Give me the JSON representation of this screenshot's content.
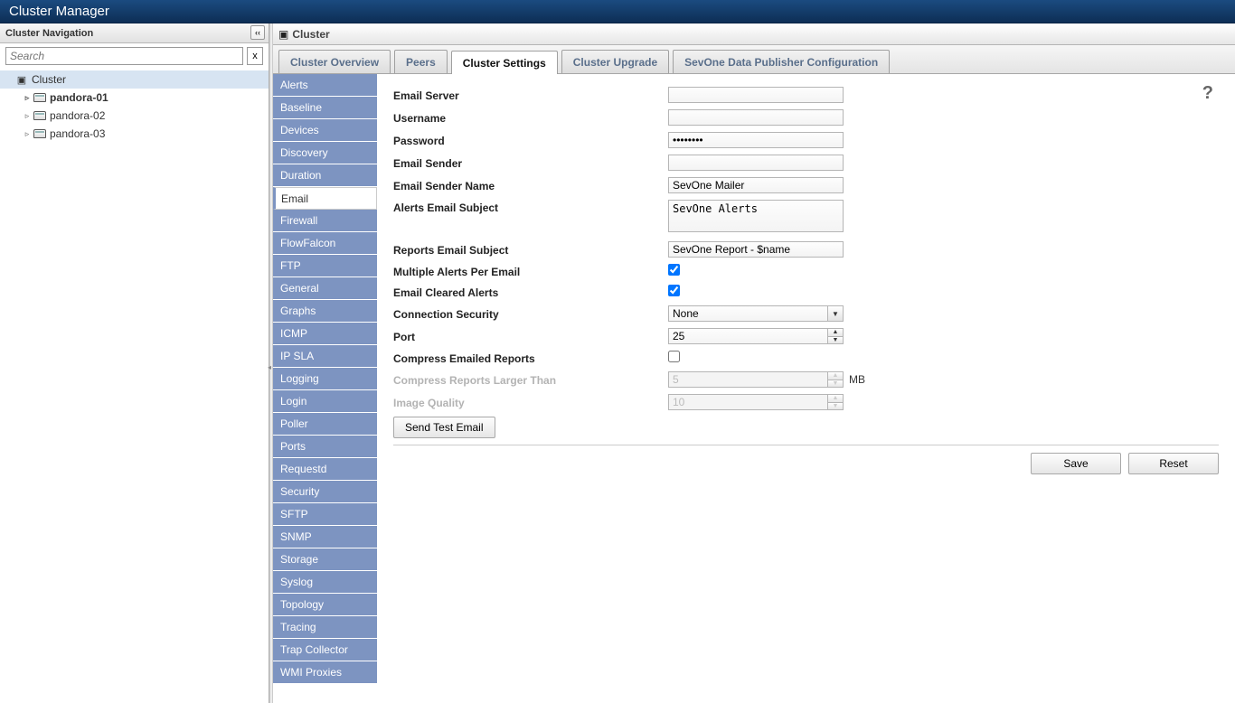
{
  "title": "Cluster Manager",
  "sidebar": {
    "header": "Cluster Navigation",
    "search_placeholder": "Search",
    "clear": "x",
    "root": "Cluster",
    "nodes": [
      {
        "label": "pandora-01",
        "bold": true
      },
      {
        "label": "pandora-02",
        "bold": false
      },
      {
        "label": "pandora-03",
        "bold": false
      }
    ]
  },
  "crumb": "Cluster",
  "tabs": [
    {
      "label": "Cluster Overview",
      "active": false
    },
    {
      "label": "Peers",
      "active": false
    },
    {
      "label": "Cluster Settings",
      "active": true
    },
    {
      "label": "Cluster Upgrade",
      "active": false
    },
    {
      "label": "SevOne Data Publisher Configuration",
      "active": false
    }
  ],
  "settings_nav": [
    "Alerts",
    "Baseline",
    "Devices",
    "Discovery",
    "Duration",
    "Email",
    "Firewall",
    "FlowFalcon",
    "FTP",
    "General",
    "Graphs",
    "ICMP",
    "IP SLA",
    "Logging",
    "Login",
    "Poller",
    "Ports",
    "Requestd",
    "Security",
    "SFTP",
    "SNMP",
    "Storage",
    "Syslog",
    "Topology",
    "Tracing",
    "Trap Collector",
    "WMI Proxies"
  ],
  "settings_nav_active": "Email",
  "form": {
    "email_server": {
      "label": "Email Server",
      "value": ""
    },
    "username": {
      "label": "Username",
      "value": ""
    },
    "password": {
      "label": "Password",
      "value": "••••••••"
    },
    "email_sender": {
      "label": "Email Sender",
      "value": ""
    },
    "email_sender_name": {
      "label": "Email Sender Name",
      "value": "SevOne Mailer"
    },
    "alerts_subject": {
      "label": "Alerts Email Subject",
      "value": "SevOne Alerts"
    },
    "reports_subject": {
      "label": "Reports Email Subject",
      "value": "SevOne Report - $name"
    },
    "multiple_alerts": {
      "label": "Multiple Alerts Per Email",
      "checked": true
    },
    "email_cleared": {
      "label": "Email Cleared Alerts",
      "checked": true
    },
    "conn_security": {
      "label": "Connection Security",
      "value": "None"
    },
    "port": {
      "label": "Port",
      "value": "25"
    },
    "compress": {
      "label": "Compress Emailed Reports",
      "checked": false
    },
    "compress_larger": {
      "label": "Compress Reports Larger Than",
      "value": "5",
      "unit": "MB"
    },
    "image_quality": {
      "label": "Image Quality",
      "value": "10"
    },
    "send_test": "Send Test Email"
  },
  "buttons": {
    "save": "Save",
    "reset": "Reset"
  },
  "help": "?"
}
